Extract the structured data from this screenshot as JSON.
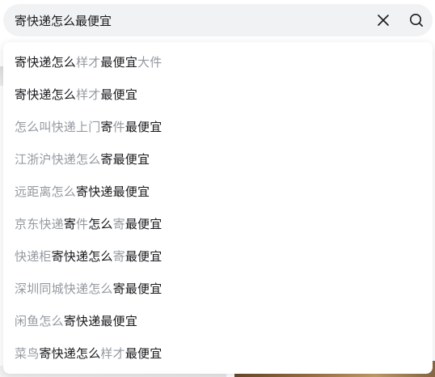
{
  "search": {
    "query": "寄快递怎么最便宜",
    "clear_icon": "close-icon",
    "search_icon": "search-icon"
  },
  "colors": {
    "matched_text": "#18191c",
    "completion_text": "#9499a0",
    "search_bg": "#f1f2f3"
  },
  "suggestions": [
    {
      "segments": [
        {
          "t": "寄快递怎么",
          "hi": true
        },
        {
          "t": "样才",
          "hi": false
        },
        {
          "t": "最便宜",
          "hi": true
        },
        {
          "t": "大件",
          "hi": false
        }
      ]
    },
    {
      "segments": [
        {
          "t": "寄快递怎么",
          "hi": true
        },
        {
          "t": "样才",
          "hi": false
        },
        {
          "t": "最便宜",
          "hi": true
        }
      ]
    },
    {
      "segments": [
        {
          "t": "怎么叫快递上门",
          "hi": false
        },
        {
          "t": "寄",
          "hi": true
        },
        {
          "t": "件",
          "hi": false
        },
        {
          "t": "最便宜",
          "hi": true
        }
      ]
    },
    {
      "segments": [
        {
          "t": "江浙沪快递怎么",
          "hi": false
        },
        {
          "t": "寄最便宜",
          "hi": true
        }
      ]
    },
    {
      "segments": [
        {
          "t": "远距离怎么",
          "hi": false
        },
        {
          "t": "寄快递最便宜",
          "hi": true
        }
      ]
    },
    {
      "segments": [
        {
          "t": "京东快递",
          "hi": false
        },
        {
          "t": "寄",
          "hi": true
        },
        {
          "t": "件",
          "hi": false
        },
        {
          "t": "怎么",
          "hi": true
        },
        {
          "t": "寄",
          "hi": false
        },
        {
          "t": "最便宜",
          "hi": true
        }
      ]
    },
    {
      "segments": [
        {
          "t": "快递柜",
          "hi": false
        },
        {
          "t": "寄快递怎么",
          "hi": true
        },
        {
          "t": "寄",
          "hi": false
        },
        {
          "t": "最便宜",
          "hi": true
        }
      ]
    },
    {
      "segments": [
        {
          "t": "深圳同城快递怎么",
          "hi": false
        },
        {
          "t": "寄最便宜",
          "hi": true
        }
      ]
    },
    {
      "segments": [
        {
          "t": "闲鱼怎么",
          "hi": false
        },
        {
          "t": "寄快递最便宜",
          "hi": true
        }
      ]
    },
    {
      "segments": [
        {
          "t": "菜鸟",
          "hi": false
        },
        {
          "t": "寄快递怎么",
          "hi": true
        },
        {
          "t": "样才",
          "hi": false
        },
        {
          "t": "最便宜",
          "hi": true
        }
      ]
    }
  ]
}
